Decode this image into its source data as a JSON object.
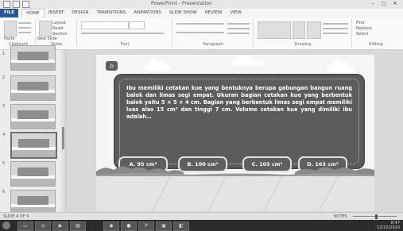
{
  "window": {
    "title": "PowerPoint - Presentation",
    "controls": [
      "–",
      "□",
      "✕"
    ]
  },
  "ribbon": {
    "tabs": [
      "FILE",
      "HOME",
      "INSERT",
      "DESIGN",
      "TRANSITIONS",
      "ANIMATIONS",
      "SLIDE SHOW",
      "REVIEW",
      "VIEW"
    ],
    "active_tab": "HOME",
    "groups": {
      "clipboard": "Clipboard",
      "slides": "Slides",
      "font": "Font",
      "paragraph": "Paragraph",
      "drawing": "Drawing",
      "editing": "Editing"
    },
    "buttons": {
      "paste": "Paste",
      "new_slide": "New Slide",
      "layout": "Layout",
      "reset": "Reset",
      "section": "Section",
      "find": "Find",
      "replace": "Replace",
      "select": "Select"
    }
  },
  "thumbnails": {
    "numbers": [
      "1",
      "2",
      "3",
      "4",
      "5",
      "6"
    ],
    "selected_index": 3
  },
  "slide": {
    "question": "Ibu memiliki cetakan kue yang bentuknya berupa gabungan bangun ruang balok dan limas segi empat. Ukuran bagian cetakan kue yang berbentuk balok yaitu 5 × 5 × 4 cm. Bagian yang berbentuk limas segi empat memiliki luas alas 15 cm² dan tinggi 7 cm. Volume cetakan kue yang dimiliki ibu adalah…",
    "options": [
      "A. 95 cm³",
      "B. 100 cm³",
      "C. 105 cm³",
      "D. 165 cm³"
    ],
    "home_icon": "home-icon"
  },
  "status": {
    "slide_info": "SLIDE 4 OF 6",
    "notes": "NOTES",
    "comments": "COMMENTS"
  },
  "taskbar": {
    "time": "8:47",
    "date": "12/10/2020"
  },
  "colors": {
    "board": "#5c5c5c",
    "file_tab": "#2b5797",
    "option_border": "#e0e0e0"
  }
}
